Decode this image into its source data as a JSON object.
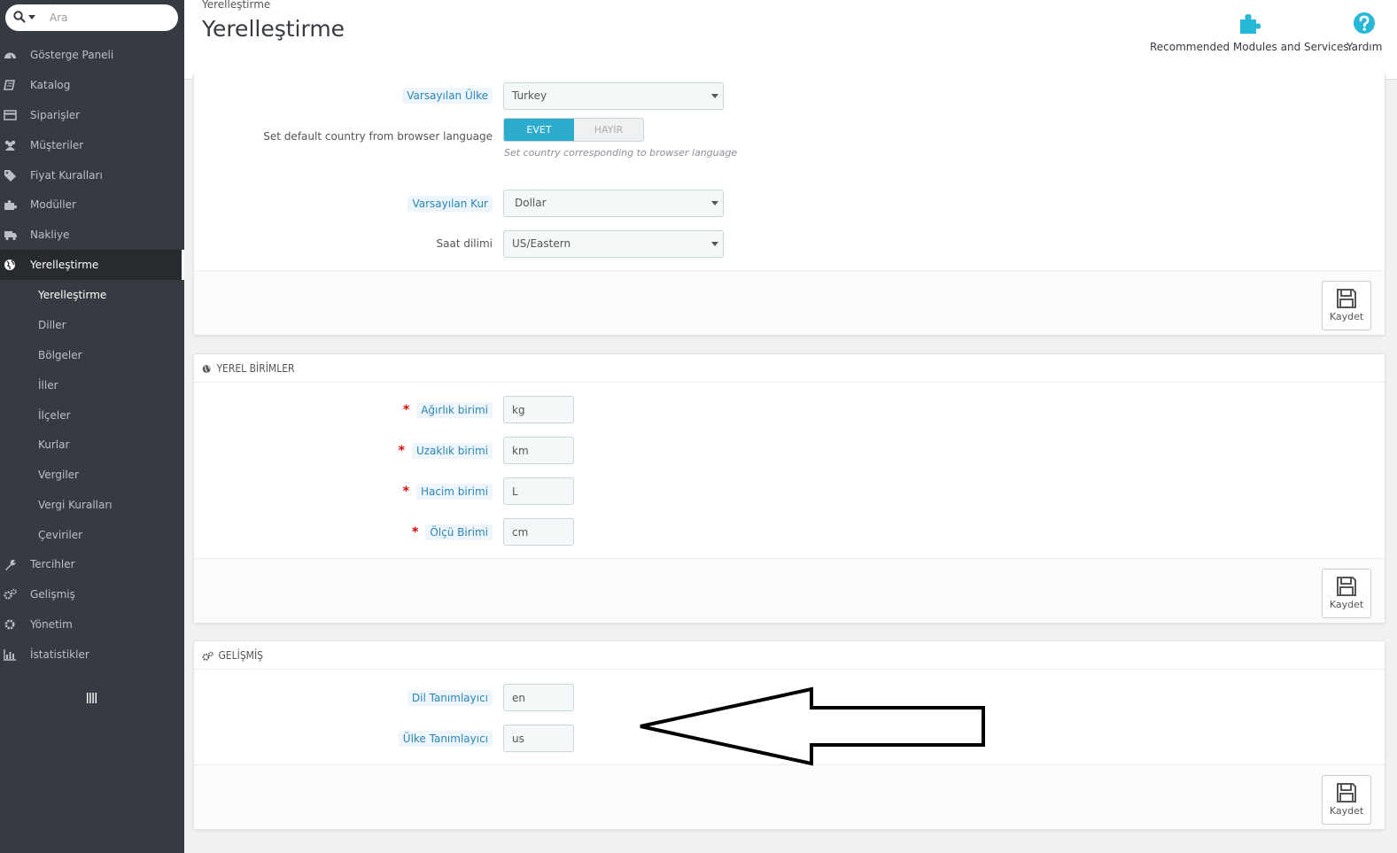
{
  "search": {
    "placeholder": "Ara"
  },
  "sidebar": {
    "items": [
      {
        "label": "Gösterge Paneli",
        "icon": "dashboard-icon"
      },
      {
        "label": "Katalog",
        "icon": "book-icon"
      },
      {
        "label": "Siparişler",
        "icon": "credit-card-icon"
      },
      {
        "label": "Müşteriler",
        "icon": "users-icon"
      },
      {
        "label": "Fiyat Kuralları",
        "icon": "tags-icon"
      },
      {
        "label": "Modüller",
        "icon": "puzzle-icon"
      },
      {
        "label": "Nakliye",
        "icon": "truck-icon"
      },
      {
        "label": "Yerelleştirme",
        "icon": "globe-icon"
      },
      {
        "label": "Tercihler",
        "icon": "wrench-icon"
      },
      {
        "label": "Gelişmiş",
        "icon": "cogs-icon"
      },
      {
        "label": "Yönetim",
        "icon": "cog-icon"
      },
      {
        "label": "İstatistikler",
        "icon": "bar-chart-icon"
      }
    ],
    "subitems": [
      {
        "label": "Yerelleştirme"
      },
      {
        "label": "Diller"
      },
      {
        "label": "Bölgeler"
      },
      {
        "label": "İller"
      },
      {
        "label": "İlçeler"
      },
      {
        "label": "Kurlar"
      },
      {
        "label": "Vergiler"
      },
      {
        "label": "Vergi Kuralları"
      },
      {
        "label": "Çeviriler"
      }
    ]
  },
  "header": {
    "breadcrumb": "Yerelleştirme",
    "title": "Yerelleştirme",
    "recommended": "Recommended Modules and Services",
    "help": "Yardım",
    "accent": "#25b9d7"
  },
  "config": {
    "default_country_label": "Varsayılan Ülke",
    "default_country_value": "Turkey",
    "browser_lang_label": "Set default country from browser language",
    "switch_yes": "EVET",
    "switch_no": "HAYIR",
    "browser_lang_help": "Set country corresponding to browser language",
    "default_currency_label": "Varsayılan Kur",
    "default_currency_value": "Dollar",
    "timezone_label": "Saat dilimi",
    "timezone_value": "US/Eastern",
    "save": "Kaydet"
  },
  "units": {
    "heading": "YEREL BİRİMLER",
    "weight_label": "Ağırlık birimi",
    "weight_value": "kg",
    "distance_label": "Uzaklık birimi",
    "distance_value": "km",
    "volume_label": "Hacim birimi",
    "volume_value": "L",
    "dimension_label": "Ölçü Birimi",
    "dimension_value": "cm",
    "required_mark": "*",
    "save": "Kaydet"
  },
  "advanced": {
    "heading": "GELİŞMİŞ",
    "lang_id_label": "Dil Tanımlayıcı",
    "lang_id_value": "en",
    "country_id_label": "Ülke Tanımlayıcı",
    "country_id_value": "us",
    "save": "Kaydet"
  }
}
